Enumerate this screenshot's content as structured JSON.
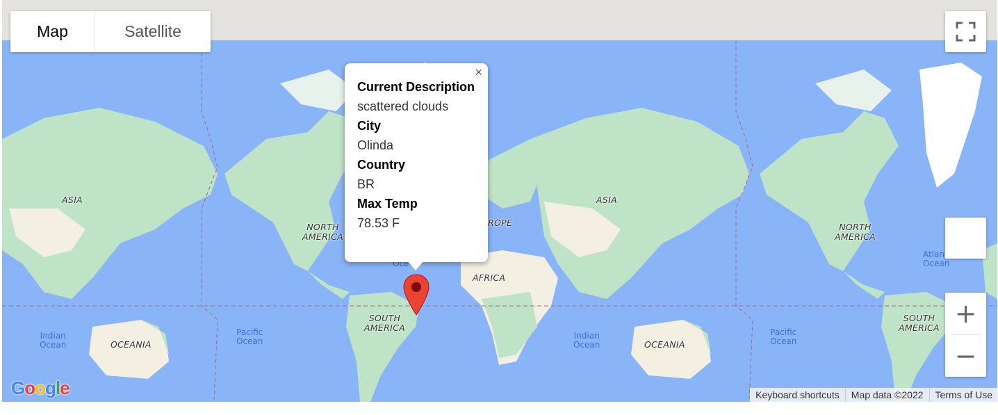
{
  "map_type": {
    "map_label": "Map",
    "satellite_label": "Satellite"
  },
  "labels": {
    "asia_1": "ASIA",
    "asia_2": "ASIA",
    "north_america_1": "NORTH\nAMERICA",
    "north_america_2": "NORTH\nAMERICA",
    "north_america_3": "NORTH\nAMERICA",
    "south_america_1": "SOUTH\nAMERICA",
    "south_america_2": "SOUTH\nAMERICA",
    "europe": "ROPE",
    "africa": "AFRICA",
    "oceania_1": "OCEANIA",
    "oceania_2": "OCEANIA",
    "indian_ocean_1": "Indian\nOcean",
    "indian_ocean_2": "Indian\nOcean",
    "pacific_ocean_1": "Pacific\nOcean",
    "pacific_ocean_2": "Pacific\nOcean",
    "atlantic_partial_1": "Oce",
    "atlantic_partial_2": "Atlan\nOcean"
  },
  "info_window": {
    "fields": [
      {
        "key": "Current Description",
        "value": "scattered clouds"
      },
      {
        "key": "City",
        "value": "Olinda"
      },
      {
        "key": "Country",
        "value": "BR"
      },
      {
        "key": "Max Temp",
        "value": "78.53 F"
      }
    ],
    "close_glyph": "×"
  },
  "zoom": {
    "in_glyph": "+",
    "out_glyph": "−"
  },
  "footer": {
    "shortcuts": "Keyboard shortcuts",
    "map_data": "Map data ©2022",
    "terms": "Terms of Use"
  },
  "logo": "Google",
  "colors": {
    "water": "#8ab4f8",
    "land": "#bfe3c6",
    "ice": "#ffffff",
    "marker": "#ea4335",
    "desert": "#f3efe2"
  }
}
